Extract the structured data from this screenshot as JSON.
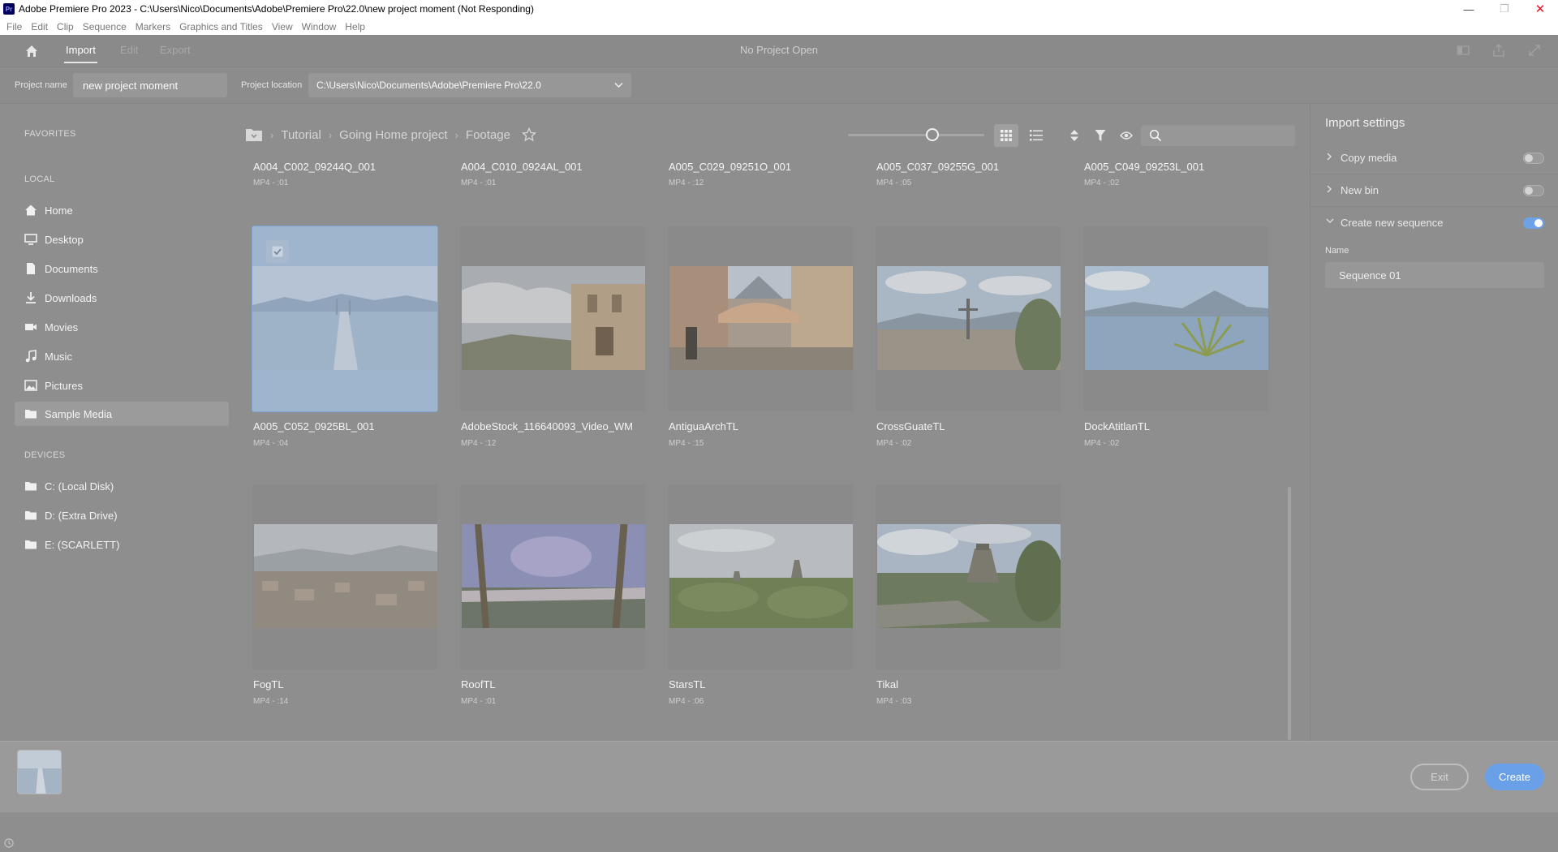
{
  "window": {
    "title": "Adobe Premiere Pro 2023 - C:\\Users\\Nico\\Documents\\Adobe\\Premiere Pro\\22.0\\new project moment (Not Responding)",
    "app_badge": "Pr",
    "minimize": "—",
    "restore": "❐",
    "close": "✕"
  },
  "menu": [
    "File",
    "Edit",
    "Clip",
    "Sequence",
    "Markers",
    "Graphics and Titles",
    "View",
    "Window",
    "Help"
  ],
  "header": {
    "tabs": {
      "import": "Import",
      "edit": "Edit",
      "export": "Export"
    },
    "status": "No Project Open"
  },
  "project": {
    "name_label": "Project name",
    "name_value": "new project moment",
    "location_label": "Project location",
    "location_value": "C:\\Users\\Nico\\Documents\\Adobe\\Premiere Pro\\22.0"
  },
  "sidebar": {
    "favorites_heading": "FAVORITES",
    "local_heading": "LOCAL",
    "local_items": [
      {
        "label": "Home",
        "icon": "home-icon"
      },
      {
        "label": "Desktop",
        "icon": "desktop-icon"
      },
      {
        "label": "Documents",
        "icon": "document-icon"
      },
      {
        "label": "Downloads",
        "icon": "download-icon"
      },
      {
        "label": "Movies",
        "icon": "movie-camera-icon"
      },
      {
        "label": "Music",
        "icon": "music-note-icon"
      },
      {
        "label": "Pictures",
        "icon": "picture-icon"
      },
      {
        "label": "Sample Media",
        "icon": "folder-icon",
        "active": true
      }
    ],
    "devices_heading": "DEVICES",
    "device_items": [
      {
        "label": "C: (Local Disk)",
        "icon": "folder-icon"
      },
      {
        "label": "D: (Extra Drive)",
        "icon": "folder-icon"
      },
      {
        "label": "E: (SCARLETT)",
        "icon": "folder-icon"
      }
    ]
  },
  "breadcrumb": [
    "Tutorial",
    "Going Home project",
    "Footage"
  ],
  "search": {
    "placeholder": ""
  },
  "media": {
    "partial_row": [
      {
        "name": "A004_C002_09244Q_001",
        "meta": "MP4 - :01"
      },
      {
        "name": "A004_C010_0924AL_001",
        "meta": "MP4 - :01"
      },
      {
        "name": "A005_C029_09251O_001",
        "meta": "MP4 - :12"
      },
      {
        "name": "A005_C037_09255G_001",
        "meta": "MP4 - :05"
      },
      {
        "name": "A005_C049_09253L_001",
        "meta": "MP4 - :02"
      }
    ],
    "row1": [
      {
        "name": "A005_C052_0925BL_001",
        "meta": "MP4 - :04",
        "selected": true
      },
      {
        "name": "AdobeStock_116640093_Video_WM",
        "meta": "MP4 - :12"
      },
      {
        "name": "AntiguaArchTL",
        "meta": "MP4 - :15"
      },
      {
        "name": "CrossGuateTL",
        "meta": "MP4 - :02"
      },
      {
        "name": "DockAtitlanTL",
        "meta": "MP4 - :02"
      }
    ],
    "row2": [
      {
        "name": "FogTL",
        "meta": "MP4 - :14"
      },
      {
        "name": "RoofTL",
        "meta": "MP4 - :01"
      },
      {
        "name": "StarsTL",
        "meta": "MP4 - :06"
      },
      {
        "name": "Tikal",
        "meta": "MP4 - :03"
      }
    ]
  },
  "import_settings": {
    "title": "Import settings",
    "copy_media": {
      "label": "Copy media",
      "enabled": false
    },
    "new_bin": {
      "label": "New bin",
      "enabled": false
    },
    "create_sequence": {
      "label": "Create new sequence",
      "enabled": true
    },
    "name_label": "Name",
    "name_value": "Sequence 01"
  },
  "footer": {
    "exit": "Exit",
    "create": "Create"
  },
  "colors": {
    "accent": "#6aa0e8",
    "overlay_gray": "#8e8e8e",
    "close": "#e81123"
  }
}
